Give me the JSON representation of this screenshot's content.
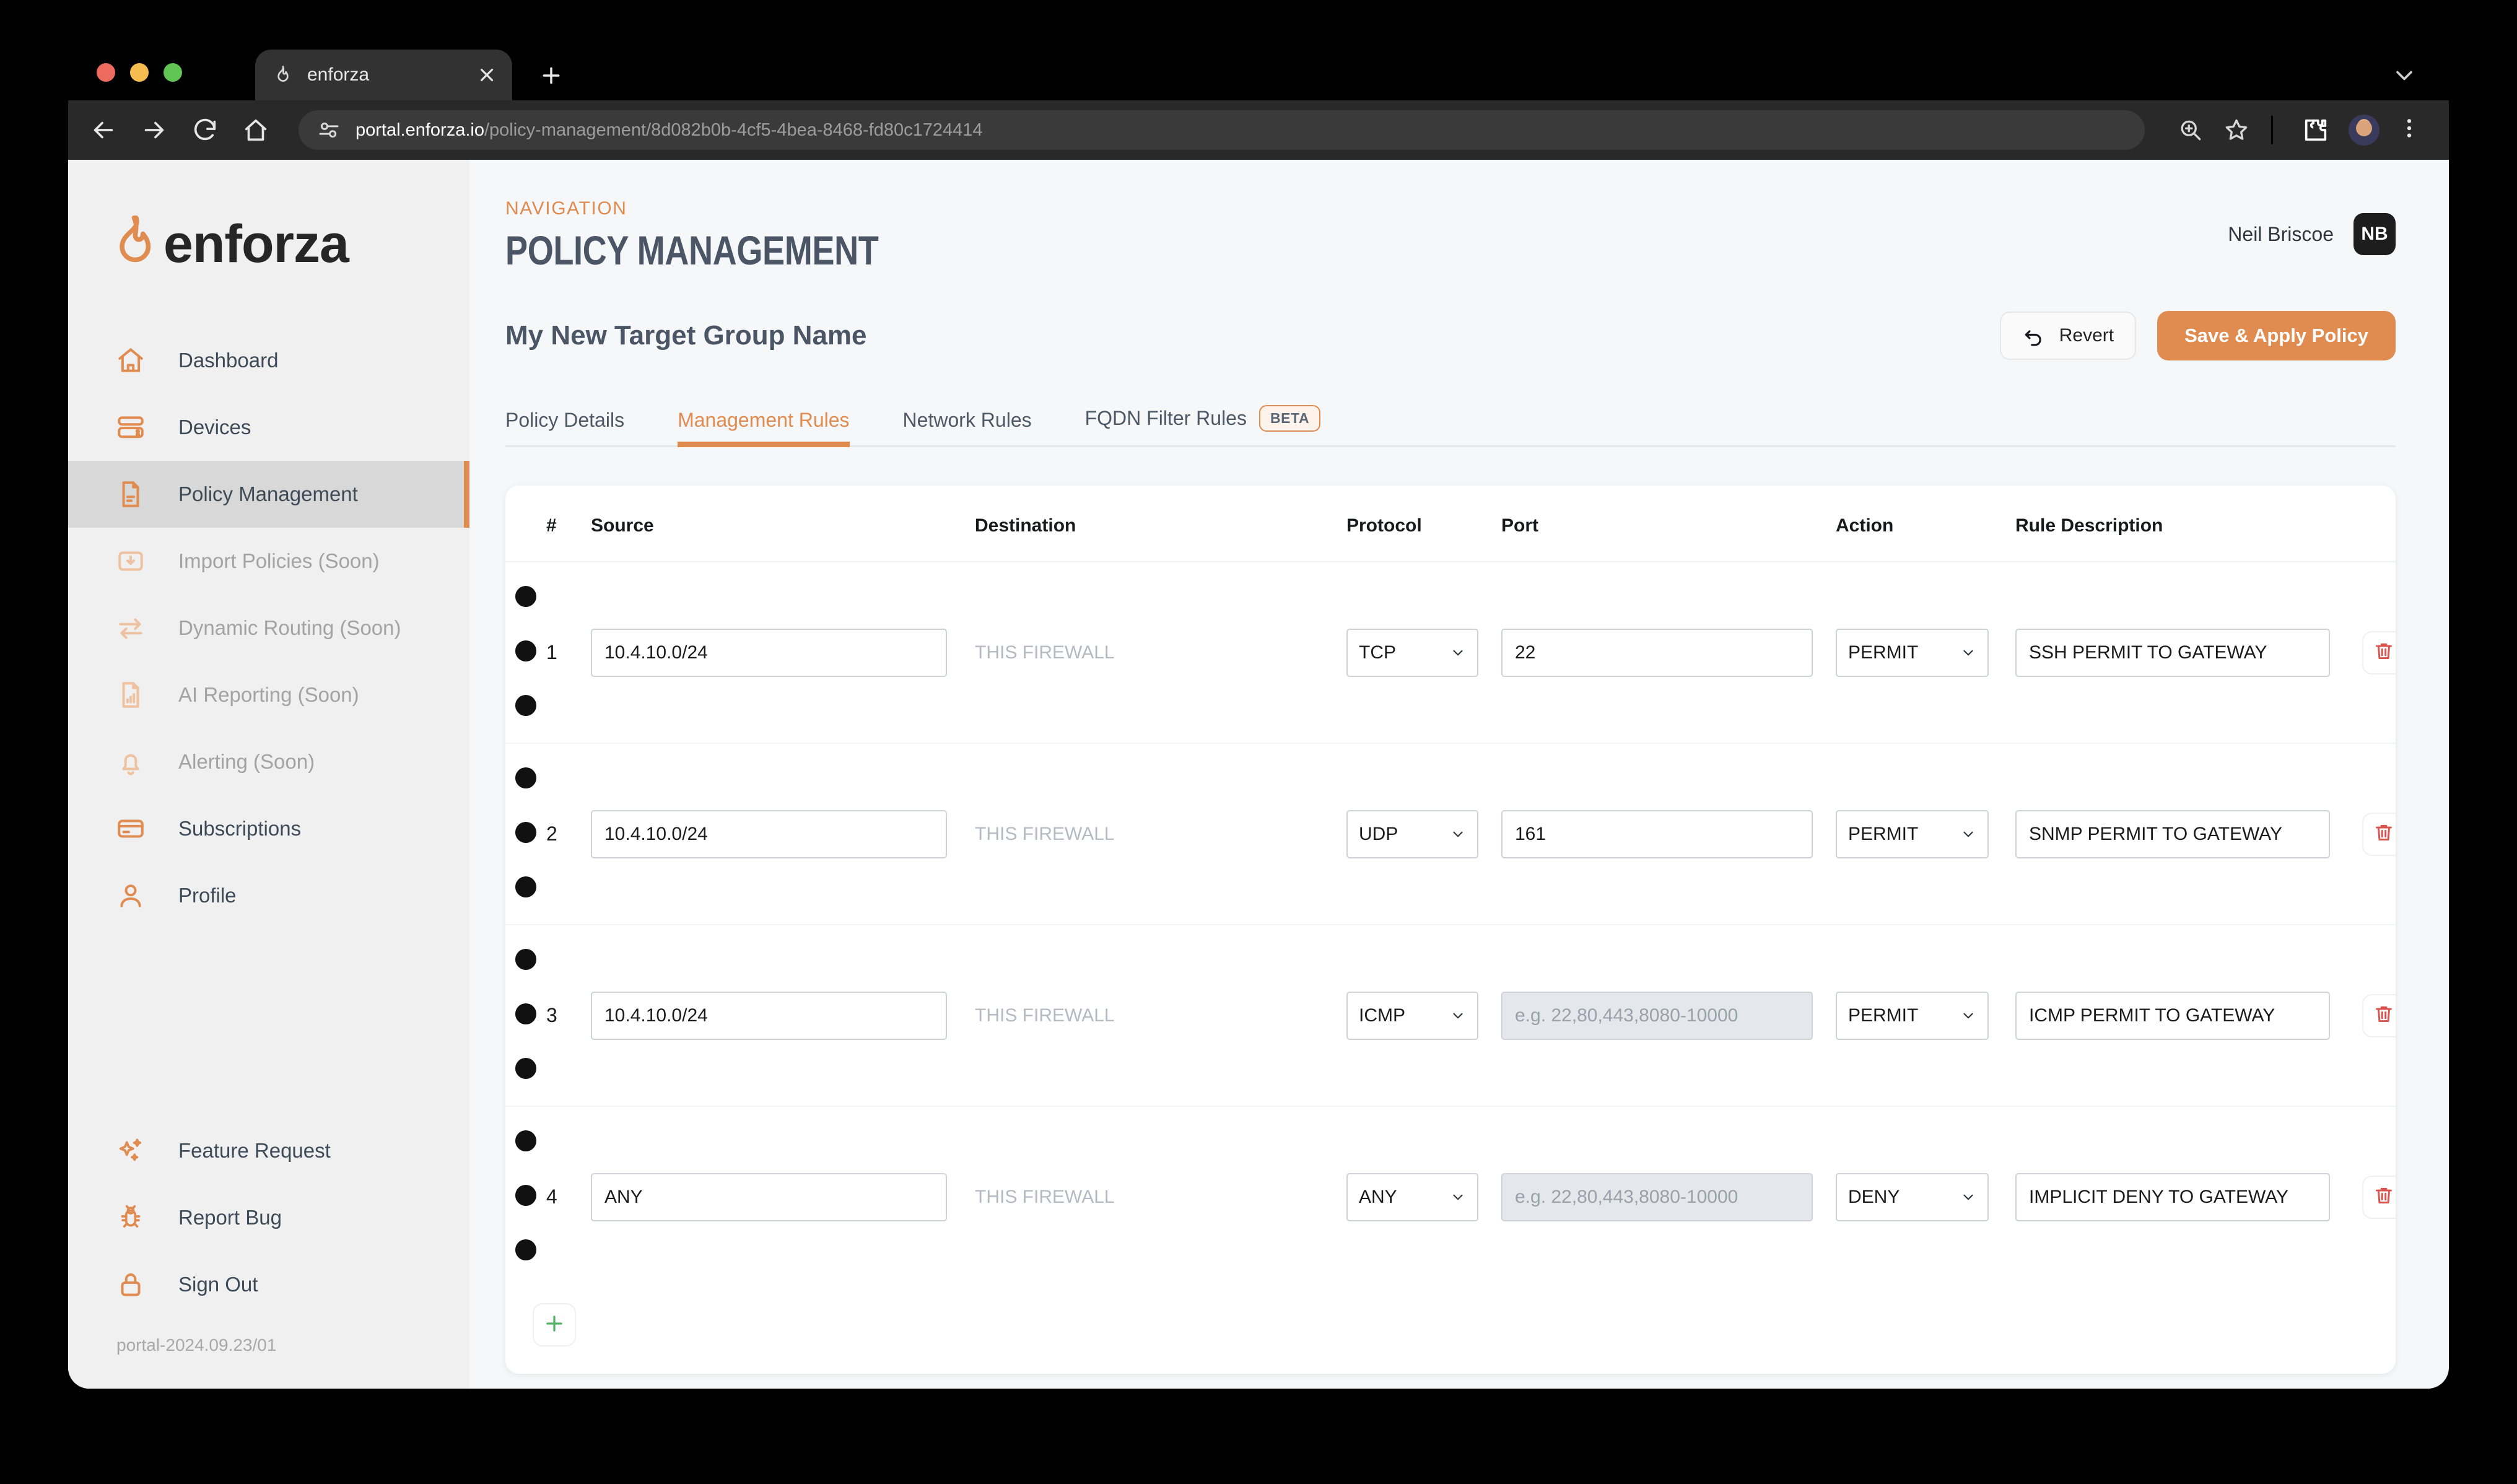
{
  "browser": {
    "tab": {
      "title": "enforza",
      "favicon": "flame-icon",
      "close_icon": "close-icon"
    },
    "new_tab_icon": "plus-icon",
    "tab_list_icon": "chevron-down-icon",
    "nav": {
      "back_icon": "back-arrow-icon",
      "forward_icon": "forward-arrow-icon",
      "reload_icon": "reload-icon",
      "home_icon": "home-icon"
    },
    "omnibox": {
      "site_info_icon": "site-settings-icon",
      "url_host": "portal.enforza.io",
      "url_path": "/policy-management/8d082b0b-4cf5-4bea-8468-fd80c1724414"
    },
    "actions": {
      "zoom_icon": "zoom-search-icon",
      "bookmark_icon": "star-icon",
      "extensions_icon": "puzzle-piece-icon",
      "profile_icon": "profile-avatar",
      "menu_icon": "three-dot-menu-icon"
    }
  },
  "sidebar": {
    "brand": {
      "wordmark": "enforza",
      "logo_icon": "flame-logo-icon"
    },
    "items": [
      {
        "label": "Dashboard",
        "icon": "home-icon",
        "state": "normal"
      },
      {
        "label": "Devices",
        "icon": "server-icon",
        "state": "normal"
      },
      {
        "label": "Policy Management",
        "icon": "document-icon",
        "state": "active"
      },
      {
        "label": "Import Policies (Soon)",
        "icon": "folder-down-icon",
        "state": "disabled"
      },
      {
        "label": "Dynamic Routing (Soon)",
        "icon": "exchange-icon",
        "state": "disabled"
      },
      {
        "label": "AI Reporting (Soon)",
        "icon": "report-chart-icon",
        "state": "disabled"
      },
      {
        "label": "Alerting (Soon)",
        "icon": "bell-icon",
        "state": "disabled"
      },
      {
        "label": "Subscriptions",
        "icon": "credit-card-icon",
        "state": "normal"
      },
      {
        "label": "Profile",
        "icon": "user-icon",
        "state": "normal"
      }
    ],
    "bottom_items": [
      {
        "label": "Feature Request",
        "icon": "sparkles-icon"
      },
      {
        "label": "Report Bug",
        "icon": "bug-icon"
      },
      {
        "label": "Sign Out",
        "icon": "lock-icon"
      }
    ],
    "version": "portal-2024.09.23/01"
  },
  "header": {
    "breadcrumb": "NAVIGATION",
    "title": "POLICY MANAGEMENT",
    "user_name": "Neil Briscoe",
    "user_initials": "NB"
  },
  "group": {
    "name": "My New Target Group Name",
    "revert_label": "Revert",
    "revert_icon": "undo-icon",
    "save_label": "Save & Apply Policy"
  },
  "tabs": [
    {
      "label": "Policy Details",
      "active": false,
      "badge": null
    },
    {
      "label": "Management Rules",
      "active": true,
      "badge": null
    },
    {
      "label": "Network Rules",
      "active": false,
      "badge": null
    },
    {
      "label": "FQDN Filter Rules",
      "active": false,
      "badge": "BETA"
    }
  ],
  "rules_table": {
    "columns": [
      "#",
      "Source",
      "Destination",
      "Protocol",
      "Port",
      "Action",
      "Rule Description"
    ],
    "port_placeholder": "e.g. 22,80,443,8080-10000",
    "add_row_icon": "plus-icon",
    "delete_icon": "trash-icon",
    "handle_icon": "drag-handle-icon",
    "rows": [
      {
        "num": "1",
        "source": "10.4.10.0/24",
        "destination": "THIS FIREWALL",
        "protocol": "TCP",
        "port": "22",
        "port_disabled": false,
        "action": "PERMIT",
        "description": "SSH PERMIT TO GATEWAY"
      },
      {
        "num": "2",
        "source": "10.4.10.0/24",
        "destination": "THIS FIREWALL",
        "protocol": "UDP",
        "port": "161",
        "port_disabled": false,
        "action": "PERMIT",
        "description": "SNMP PERMIT TO GATEWAY"
      },
      {
        "num": "3",
        "source": "10.4.10.0/24",
        "destination": "THIS FIREWALL",
        "protocol": "ICMP",
        "port": "",
        "port_disabled": true,
        "action": "PERMIT",
        "description": "ICMP PERMIT TO GATEWAY"
      },
      {
        "num": "4",
        "source": "ANY",
        "destination": "THIS FIREWALL",
        "protocol": "ANY",
        "port": "",
        "port_disabled": true,
        "action": "DENY",
        "description": "IMPLICIT DENY TO GATEWAY"
      }
    ]
  },
  "colors": {
    "accent": "#e08b4f",
    "title": "#4a5565",
    "danger": "#d9534f",
    "success": "#52b265",
    "sidebar_bg": "#f0f0f0",
    "page_bg": "#f6f7f8"
  }
}
